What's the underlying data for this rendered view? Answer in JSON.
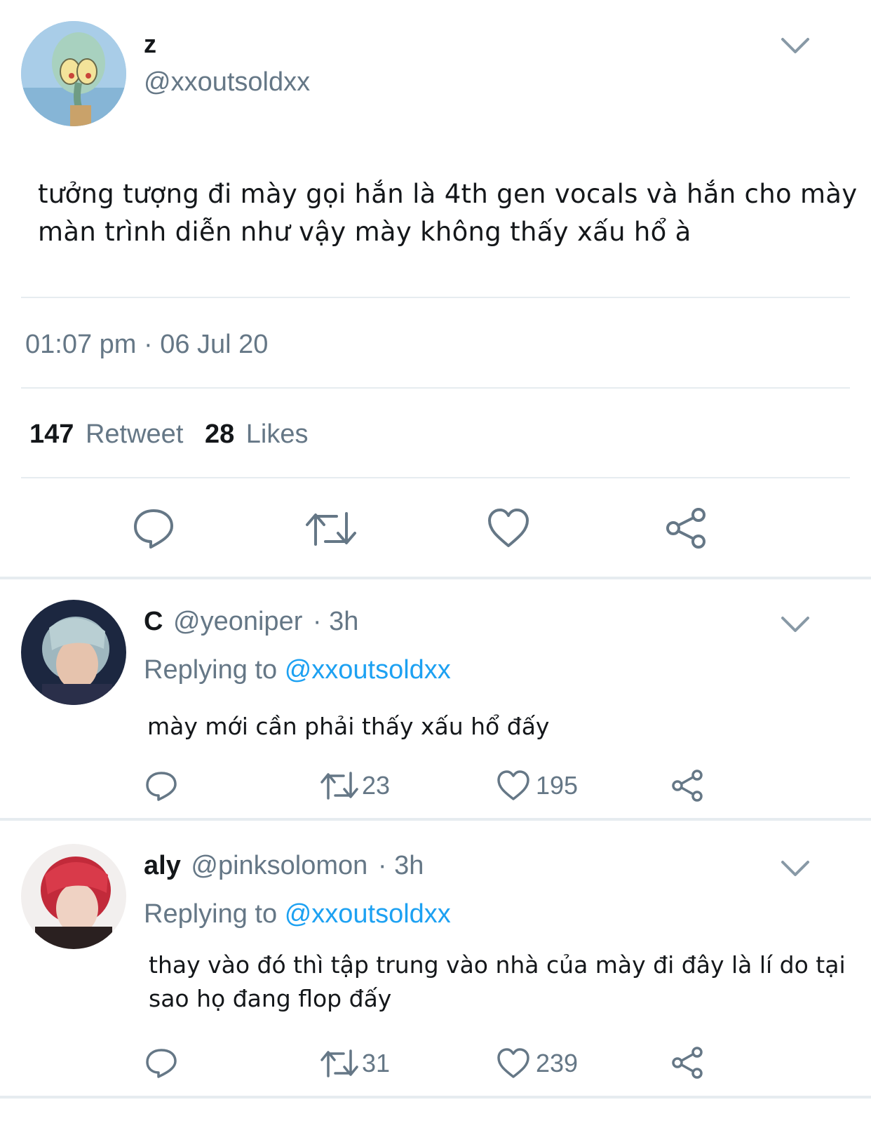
{
  "main_tweet": {
    "display_name": "z",
    "handle": "@xxoutsoldxx",
    "text_line1": "tưởng tượng đi mày gọi hắn là 4th gen vocals và hắn cho mày",
    "text_line2": "màn trình diễn như vậy mày không thấy xấu hổ à",
    "timestamp": "01:07 pm · 06 Jul 20",
    "retweet_count": "147",
    "retweet_label": "Retweet",
    "like_count": "28",
    "like_label": "Likes"
  },
  "replies": [
    {
      "display_name": "C",
      "handle": "@yeoniper",
      "time": "· 3h",
      "replying_prefix": "Replying to",
      "replying_handle": "@xxoutsoldxx",
      "text_line1": "mày mới cần phải thấy xấu hổ đấy",
      "text_line2": "",
      "retweets": "23",
      "likes": "195"
    },
    {
      "display_name": "aly",
      "handle": "@pinksolomon",
      "time": "· 3h",
      "replying_prefix": "Replying to",
      "replying_handle": "@xxoutsoldxx",
      "text_line1": "thay vào đó thì tập trung vào nhà của mày đi đây là lí do tại",
      "text_line2": "sao họ đang flop đấy",
      "retweets": "31",
      "likes": "239"
    }
  ],
  "icons": [
    "chevron-down-icon",
    "reply-icon",
    "retweet-icon",
    "heart-icon",
    "share-icon"
  ],
  "colors": {
    "text": "#14171a",
    "muted": "#657786",
    "link": "#1da1f2",
    "divider": "#e6ecf0"
  }
}
